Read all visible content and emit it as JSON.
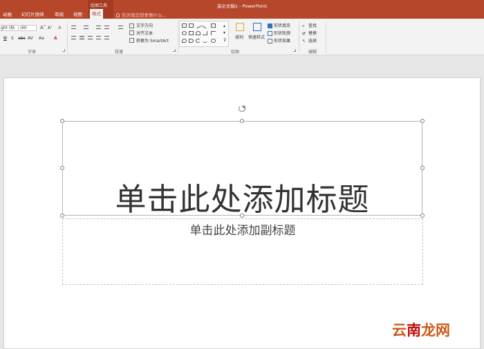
{
  "window": {
    "title": "演示文稿1 - PowerPoint",
    "contextual_group": "绘图工具"
  },
  "tabs": [
    {
      "label": "动画"
    },
    {
      "label": "幻灯片放映"
    },
    {
      "label": "审阅"
    },
    {
      "label": "视图"
    },
    {
      "label": "格式",
      "active": true
    }
  ],
  "tell_me": "告诉我您想要做什么...",
  "ribbon": {
    "font": {
      "name_value": "ght (标",
      "size_value": "60",
      "group_label": "字体"
    },
    "paragraph": {
      "text_direction": "文字方向",
      "align_text": "对齐文本",
      "convert_smartart": "转换为 SmartArt",
      "group_label": "段落"
    },
    "drawing": {
      "arrange": "排列",
      "quick_styles": "快速样式",
      "shape_fill": "形状填充",
      "shape_outline": "形状轮廓",
      "shape_effects": "形状效果",
      "group_label": "绘图"
    },
    "editing": {
      "find": "查找",
      "replace": "替换",
      "select": "选择",
      "group_label": "编辑"
    }
  },
  "slide": {
    "title_placeholder": "单击此处添加标题",
    "subtitle_placeholder": "单击此处添加副标题"
  },
  "watermark": {
    "part1": "云",
    "part2": "南",
    "part3": "龙网"
  },
  "colors": {
    "accent": "#b7472a",
    "ribbon_bg": "#f3f3f3",
    "workspace_bg": "#e6e6e6"
  }
}
